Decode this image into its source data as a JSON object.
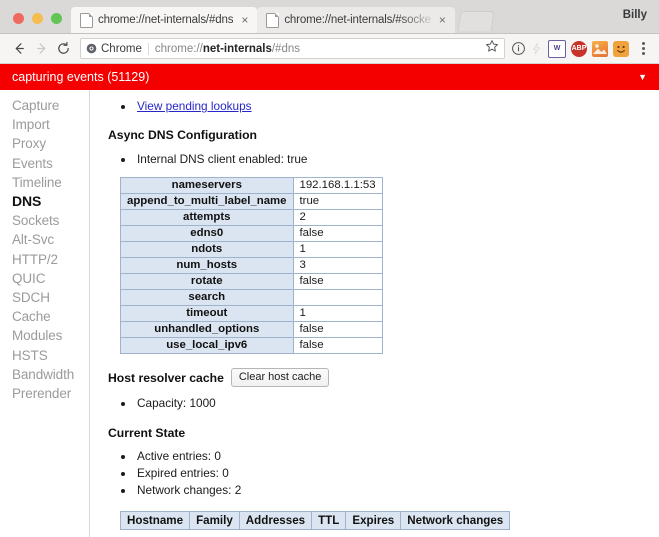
{
  "window": {
    "profile_name": "Billy",
    "traffic_lights": [
      "close-red",
      "minimize-yellow",
      "zoom-green"
    ]
  },
  "tabs": [
    {
      "title": "chrome://net-internals/#dns",
      "active": true,
      "close_label": "×"
    },
    {
      "title": "chrome://net-internals/#socke",
      "active": false,
      "close_label": "×"
    }
  ],
  "toolbar": {
    "back_label": "Back",
    "forward_label": "Forward",
    "reload_label": "Reload",
    "secure_label": "Chrome",
    "url_prefix": "chrome://",
    "url_bold": "net-internals",
    "url_suffix": "/#dns",
    "bookmark_label": "Bookmark this page",
    "page_info_label": "Page info",
    "extensions": [
      {
        "name": "office-extension",
        "glyph": "W"
      },
      {
        "name": "adblock-plus-extension",
        "glyph": "ABP"
      },
      {
        "name": "image-extension",
        "glyph": ""
      },
      {
        "name": "emoji-extension",
        "glyph": ""
      }
    ],
    "menu_label": "Customize and control Google Chrome"
  },
  "banner": {
    "text": "capturing events (51129)",
    "caret": "▼",
    "color": "#f40000"
  },
  "sidebar": {
    "items": [
      {
        "label": "Capture",
        "selected": false
      },
      {
        "label": "Import",
        "selected": false
      },
      {
        "label": "Proxy",
        "selected": false
      },
      {
        "label": "Events",
        "selected": false
      },
      {
        "label": "Timeline",
        "selected": false
      },
      {
        "label": "DNS",
        "selected": true
      },
      {
        "label": "Sockets",
        "selected": false
      },
      {
        "label": "Alt-Svc",
        "selected": false
      },
      {
        "label": "HTTP/2",
        "selected": false
      },
      {
        "label": "QUIC",
        "selected": false
      },
      {
        "label": "SDCH",
        "selected": false
      },
      {
        "label": "Cache",
        "selected": false
      },
      {
        "label": "Modules",
        "selected": false
      },
      {
        "label": "HSTS",
        "selected": false
      },
      {
        "label": "Bandwidth",
        "selected": false
      },
      {
        "label": "Prerender",
        "selected": false
      }
    ]
  },
  "main": {
    "pending_lookups_link": "View pending lookups",
    "async_heading": "Async DNS Configuration",
    "internal_client": "Internal DNS client enabled: true",
    "config_table": {
      "rows": [
        {
          "key": "nameservers",
          "value": "192.168.1.1:53"
        },
        {
          "key": "append_to_multi_label_name",
          "value": "true"
        },
        {
          "key": "attempts",
          "value": "2"
        },
        {
          "key": "edns0",
          "value": "false"
        },
        {
          "key": "ndots",
          "value": "1"
        },
        {
          "key": "num_hosts",
          "value": "3"
        },
        {
          "key": "rotate",
          "value": "false"
        },
        {
          "key": "search",
          "value": ""
        },
        {
          "key": "timeout",
          "value": "1"
        },
        {
          "key": "unhandled_options",
          "value": "false"
        },
        {
          "key": "use_local_ipv6",
          "value": "false"
        }
      ]
    },
    "host_cache_heading": "Host resolver cache",
    "clear_cache_button": "Clear host cache",
    "capacity": "Capacity: 1000",
    "current_state_heading": "Current State",
    "state_items": [
      "Active entries: 0",
      "Expired entries: 0",
      "Network changes: 2"
    ],
    "hosts_table": {
      "columns": [
        "Hostname",
        "Family",
        "Addresses",
        "TTL",
        "Expires",
        "Network changes"
      ]
    }
  }
}
